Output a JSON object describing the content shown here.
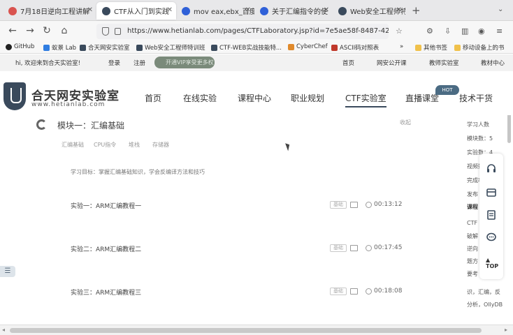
{
  "browser": {
    "tabs": [
      {
        "label": "7月18日逆向工程讲解",
        "active": false
      },
      {
        "label": "CTF从入门到实践",
        "active": true
      },
      {
        "label": "mov eax,ebx_百度",
        "active": false
      },
      {
        "label": "关于汇编指令的使",
        "active": false
      },
      {
        "label": "Web安全工程师特",
        "active": false
      }
    ],
    "new_tab": "+",
    "url": "https://www.hetianlab.com/pages/CTFLaboratory.jsp?id=7e5ae58f-8487-42",
    "bookmarks": [
      {
        "label": "GitHub",
        "color": "#222222"
      },
      {
        "label": "蚁景 Lab",
        "color": "#2f7de1"
      },
      {
        "label": "合天网安实验室",
        "color": "#3a4a5c"
      },
      {
        "label": "Web安全工程师特训班",
        "color": "#3a4a5c"
      },
      {
        "label": "CTF-WEB实战技能特...",
        "color": "#3a4a5c"
      },
      {
        "label": "CyberChef",
        "color": "#e08a2c"
      },
      {
        "label": "ASCII码对照表",
        "color": "#c0392b"
      }
    ],
    "bookmarks_right": [
      {
        "label": "其他书签"
      },
      {
        "label": "移动设备上的书"
      }
    ]
  },
  "site": {
    "welcome": "hi, 欢迎来到合天实验室!",
    "login": "登录",
    "register": "注册",
    "vip_badge": "开通VIP享受更多权益",
    "top_links": [
      "首页",
      "网安公开课",
      "教师实验室",
      "教材中心"
    ],
    "logo_title": "合天网安实验室",
    "logo_url": "www.hetianlab.com",
    "menu": [
      {
        "label": "首页",
        "active": false
      },
      {
        "label": "在线实验",
        "active": false
      },
      {
        "label": "课程中心",
        "active": false
      },
      {
        "label": "职业规划",
        "active": false
      },
      {
        "label": "CTF实验室",
        "active": true
      },
      {
        "label": "直播课堂",
        "active": false
      },
      {
        "label": "技术干货",
        "active": false
      }
    ],
    "menu_badge": "HOT"
  },
  "module": {
    "title": "模块一：汇编基础",
    "collapse": "收起",
    "tags": [
      "汇编基础",
      "CPU指令",
      "堆栈",
      "存储器"
    ],
    "goal": "学习目标：掌握汇编基础知识，学会反编译方法和技巧",
    "experiments": [
      {
        "title": "实验一：ARM汇编教程一",
        "difficulty": "基础",
        "duration": "00:13:12"
      },
      {
        "title": "实验二：ARM汇编教程二",
        "difficulty": "基础",
        "duration": "00:17:45"
      },
      {
        "title": "实验三：ARM汇编教程三",
        "difficulty": "基础",
        "duration": "00:18:08"
      }
    ]
  },
  "sidebar": {
    "stats": [
      "学习人数",
      "模块数：5",
      "实验数：4",
      "视频数：4",
      "完成率",
      "发布"
    ],
    "intro_heading": "课程",
    "intro_lines": [
      "CTF",
      "破解",
      "逆向",
      "题方",
      "要考",
      "识，汇编，反",
      "分析，OllyDB"
    ],
    "float_buttons": [
      "headset-icon",
      "card-icon",
      "doc-icon",
      "chat-icon"
    ],
    "top_label": "TOP"
  }
}
